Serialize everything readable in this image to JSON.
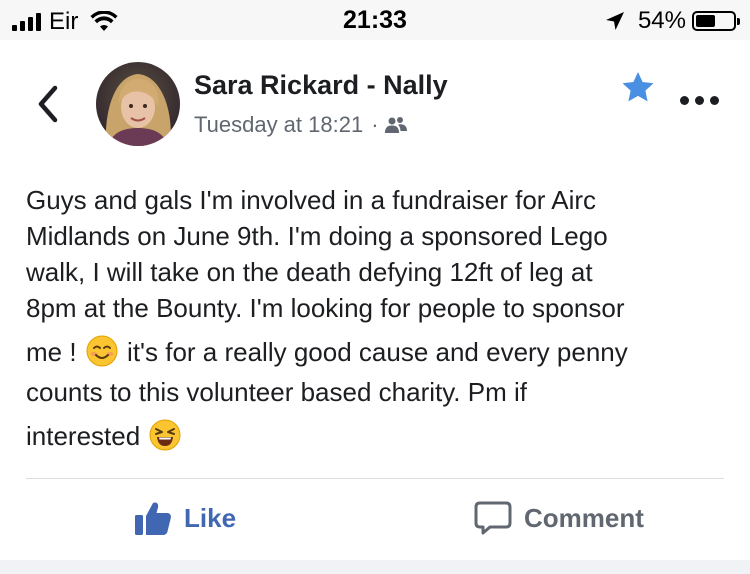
{
  "status_bar": {
    "carrier": "Eir",
    "time": "21:33",
    "battery_percent": "54%",
    "battery_level": 0.54,
    "icons": [
      "signal-icon",
      "wifi-icon",
      "location-arrow-icon",
      "battery-icon"
    ]
  },
  "post": {
    "author": "Sara Rickard - Nally",
    "timestamp": "Tuesday at 18:21",
    "separator": "·",
    "audience_icon": "friends-icon",
    "body_lines": [
      "Guys and gals I'm involved in a fundraiser for Airc",
      "Midlands on June 9th. I'm doing a sponsored Lego",
      "walk, I will take on the death defying 12ft of leg at",
      "8pm at the Bounty.  I'm looking for people to sponsor"
    ],
    "body_line5_a": "me !",
    "body_line5_b": "it's for a really good cause and every penny",
    "body_line6": "counts to this volunteer based charity. Pm if",
    "body_line7": "interested",
    "emojis": [
      "smiling-emoji",
      "laughing-emoji"
    ]
  },
  "actions": {
    "like_label": "Like",
    "comment_label": "Comment"
  },
  "colors": {
    "accent": "#4267b2",
    "star": "#4a90e2",
    "secondary_text": "#606770"
  }
}
